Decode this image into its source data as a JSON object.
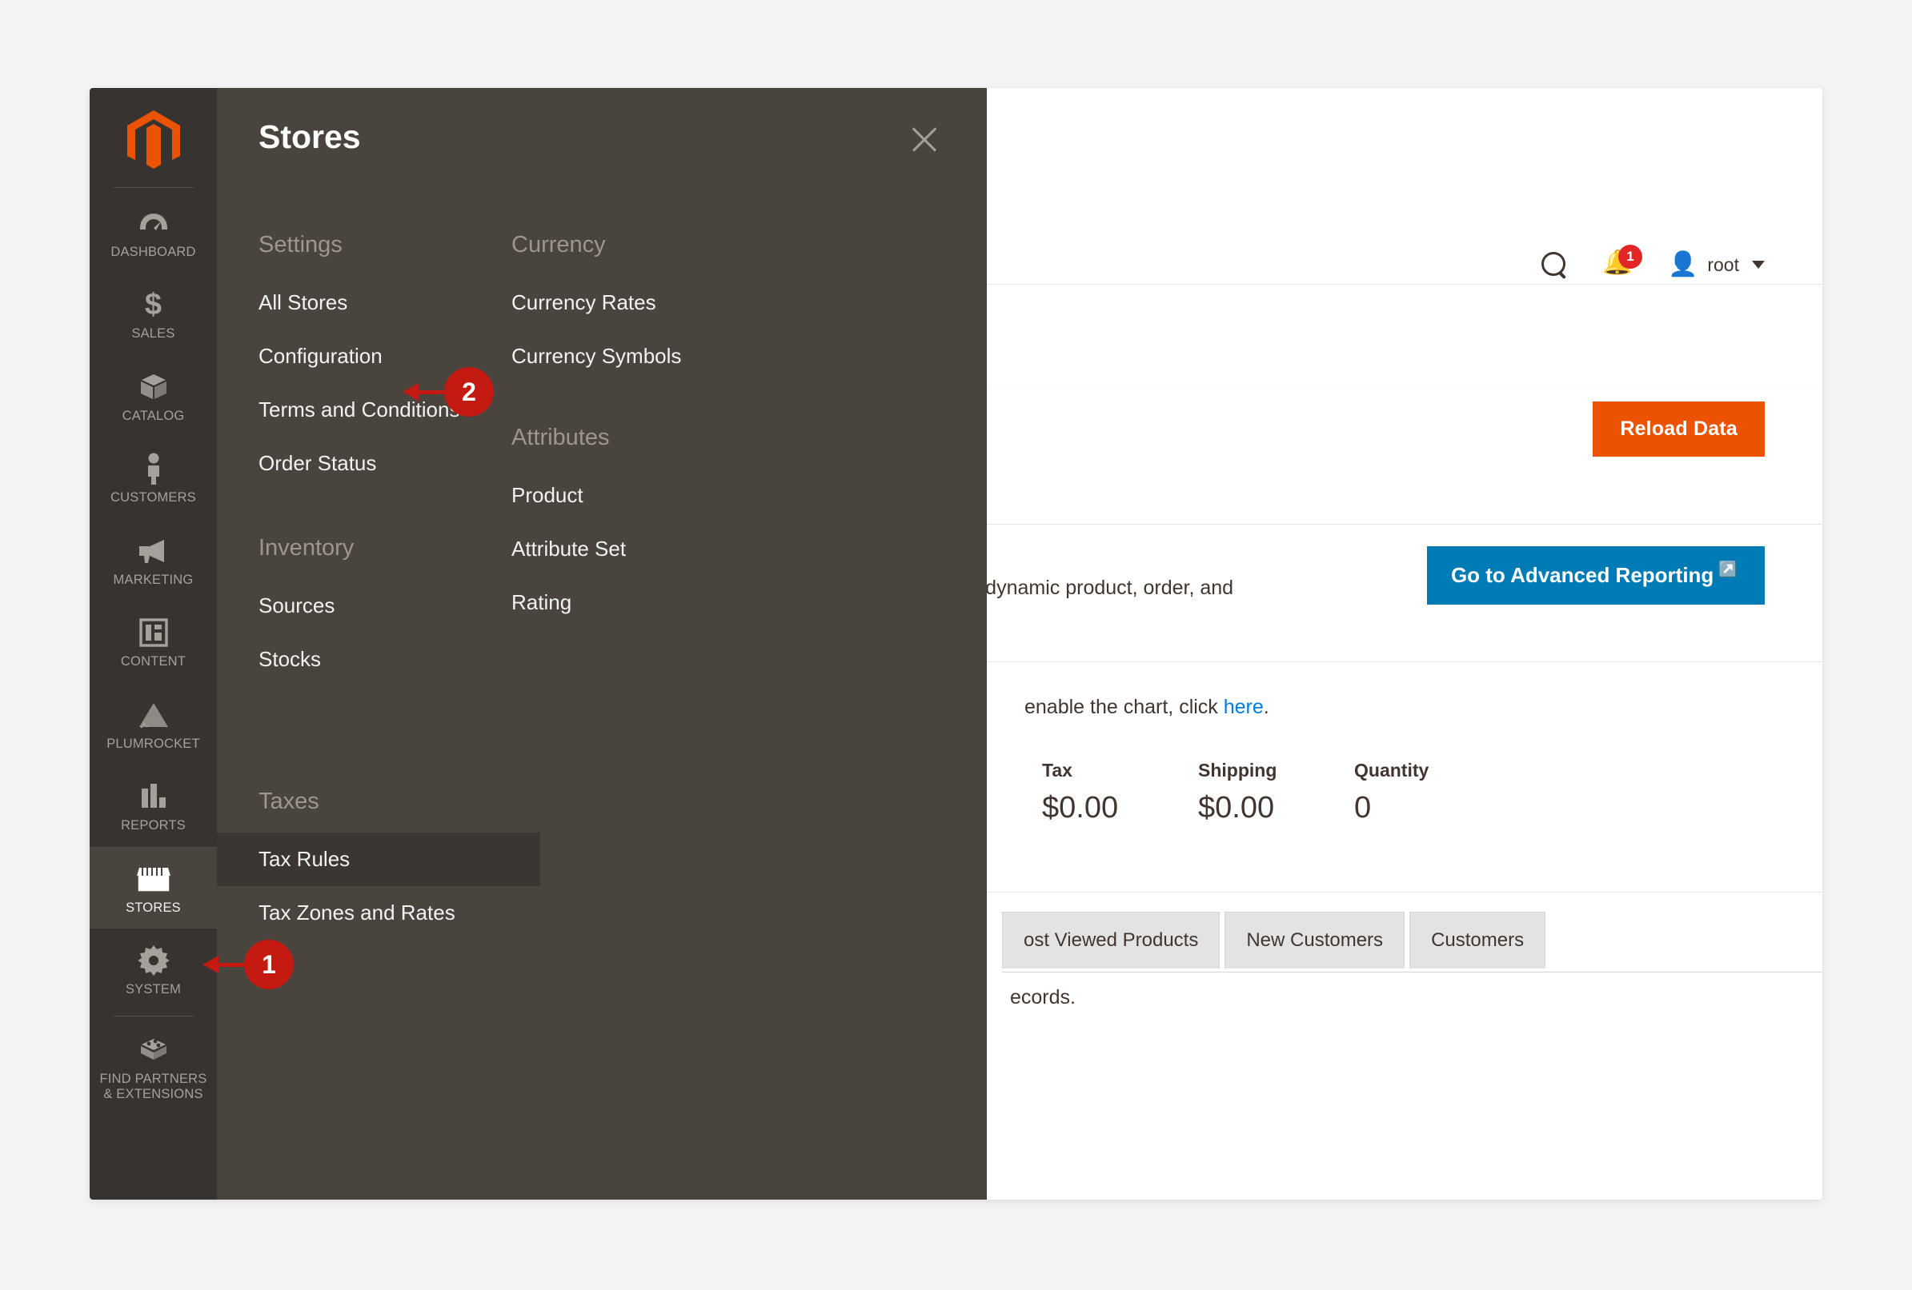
{
  "sidebar": {
    "logo_name": "magento-logo",
    "items": [
      {
        "label": "Dashboard",
        "icon": "gauge-icon",
        "active": false
      },
      {
        "label": "Sales",
        "icon": "dollar-icon",
        "active": false
      },
      {
        "label": "Catalog",
        "icon": "box-icon",
        "active": false
      },
      {
        "label": "Customers",
        "icon": "person-icon",
        "active": false
      },
      {
        "label": "Marketing",
        "icon": "megaphone-icon",
        "active": false
      },
      {
        "label": "Content",
        "icon": "layout-icon",
        "active": false
      },
      {
        "label": "Plumrocket",
        "icon": "pyramid-icon",
        "active": false
      },
      {
        "label": "Reports",
        "icon": "bar-chart-icon",
        "active": false
      },
      {
        "label": "Stores",
        "icon": "storefront-icon",
        "active": true
      },
      {
        "label": "System",
        "icon": "gear-icon",
        "active": false
      },
      {
        "label": "Find Partners\n& Extensions",
        "icon": "puzzle-brick-icon",
        "active": false
      }
    ]
  },
  "flyout": {
    "title": "Stores",
    "close_label": "close-icon",
    "columns": [
      {
        "groups": [
          {
            "heading": "Settings",
            "items": [
              {
                "label": "All Stores",
                "highlight": false
              },
              {
                "label": "Configuration",
                "highlight": false
              },
              {
                "label": "Terms and Conditions",
                "highlight": false
              },
              {
                "label": "Order Status",
                "highlight": false
              }
            ]
          },
          {
            "heading": "Inventory",
            "items": [
              {
                "label": "Sources",
                "highlight": false
              },
              {
                "label": "Stocks",
                "highlight": false
              }
            ]
          },
          {
            "heading": "Taxes",
            "items": [
              {
                "label": "Tax Rules",
                "highlight": true
              },
              {
                "label": "Tax Zones and Rates",
                "highlight": false
              }
            ]
          }
        ]
      },
      {
        "groups": [
          {
            "heading": "Currency",
            "items": [
              {
                "label": "Currency Rates",
                "highlight": false
              },
              {
                "label": "Currency Symbols",
                "highlight": false
              }
            ]
          },
          {
            "heading": "Attributes",
            "items": [
              {
                "label": "Product",
                "highlight": false
              },
              {
                "label": "Attribute Set",
                "highlight": false
              },
              {
                "label": "Rating",
                "highlight": false
              }
            ]
          }
        ]
      }
    ]
  },
  "annotations": [
    {
      "number": "1",
      "target": "sidebar-item-stores"
    },
    {
      "number": "2",
      "target": "menu-item-configuration"
    }
  ],
  "header": {
    "search_icon": "search-icon",
    "notifications_icon": "bell-icon",
    "notifications_count": "1",
    "user_icon": "user-avatar-icon",
    "user_name": "root",
    "caret_icon": "chevron-down-icon"
  },
  "main": {
    "reload_button": "Reload Data",
    "advanced_reporting_text": "ur dynamic product, order, and",
    "advanced_reporting_button": "Go to Advanced Reporting",
    "advanced_reporting_external_icon": "external-link-icon",
    "chart_note_prefix": "enable the chart, click ",
    "chart_note_link": "here",
    "chart_note_suffix": ".",
    "stats": [
      {
        "label": "Tax",
        "value": "$0.00"
      },
      {
        "label": "Shipping",
        "value": "$0.00"
      },
      {
        "label": "Quantity",
        "value": "0"
      }
    ],
    "tabs": [
      {
        "label": "ost Viewed Products"
      },
      {
        "label": "New Customers"
      },
      {
        "label": "Customers"
      }
    ],
    "records_note": "ecords."
  },
  "colors": {
    "accent_orange": "#eb5202",
    "accent_blue": "#007bb6",
    "link_blue": "#007bdb",
    "badge_red": "#e22626",
    "callout_red": "#c51a12",
    "sidebar_bg": "#373330",
    "flyout_bg": "#4a443f"
  }
}
